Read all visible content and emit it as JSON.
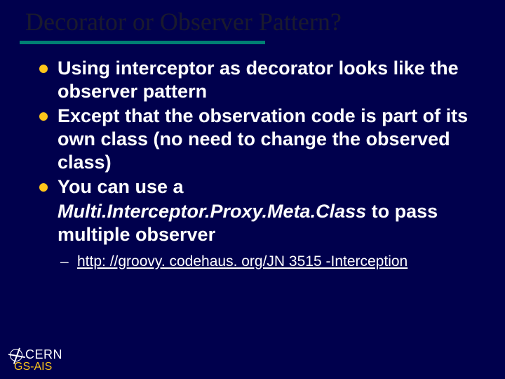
{
  "title": "Decorator or Observer Pattern?",
  "bullets": [
    "Using interceptor as decorator looks like the observer pattern",
    "Except that the observation code is part of its own class (no need to change the observed class)",
    "You can use a"
  ],
  "class_name": "Multi.Interceptor.Proxy.Meta.Class",
  "cont_tail": " to pass multiple observer",
  "link_prefix": "  ",
  "link_text": "http: //groovy. codehaus. org/JN 3515 -Interception",
  "footer": {
    "org": "CERN",
    "dept": "GS-AIS"
  }
}
